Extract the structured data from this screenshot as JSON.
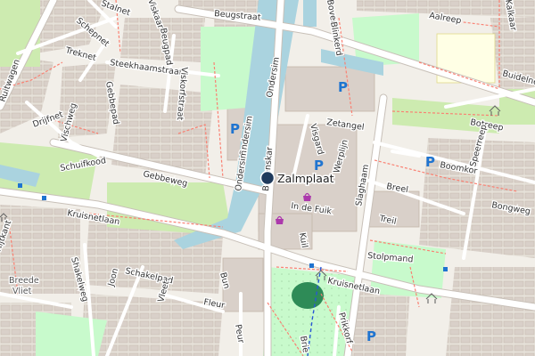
{
  "map": {
    "place": {
      "name": "Zalmplaat"
    },
    "streets": {
      "stalnet": "Stalnet",
      "viskaar": "Viskaar",
      "beugstraat": "Beugstraat",
      "bovensloot": "Bovensl",
      "aalreep": "Aalreep",
      "kalkaar": "Kalkaar",
      "schepnet": "Schepnet",
      "treknet": "Treknet",
      "beugpad": "Beugpad",
      "blinkerd": "Blinkerd",
      "steekhaamstraat": "Steekhaamstraat",
      "ruitwagen": "Ruitwagen",
      "gebbepad": "Gebbepad",
      "viskorfstraat": "Viskorfstraat",
      "ondersim_1": "Ondersim",
      "ondersim_2": "Ondersim",
      "ondersim_3": "Ondersim",
      "visgard": "Visgard",
      "zetangel": "Zetangel",
      "buidelnet": "Buidelnet",
      "botreep": "Botreep",
      "drijfnet": "Drijfnet",
      "vischweg": "Visch­weg",
      "schuifkood": "Schuifkood",
      "werplijn": "Werplijn",
      "speerreep": "Speerreep",
      "boomkor": "Boomkor",
      "gebbeweg": "Gebbeweg",
      "bovenskar": "Bovenskar",
      "slaghaam": "Slaghaam",
      "breel": "Breel",
      "bongweg": "Bongweg",
      "kruisnetlaan_1": "Kruisnetlaan",
      "in_de_fuik": "In de Fuik",
      "treil": "Treil",
      "kuil": "Kuil",
      "stolpmand": "Stolpmand",
      "shakelweg": "Shakelweg",
      "schakelpad": "Schakelpad",
      "bun": "Bun",
      "kruisnetlaan_2": "Kruisnetlaan",
      "joon": "Joon",
      "vleet": "Vleet",
      "fleur": "Fleur",
      "peur": "Peur",
      "brie": "Brie",
      "prikkorf": "Prikkorf",
      "rijtkant": "Rijtkant"
    },
    "districts": {
      "breede_vliet_1": "Breede",
      "breede_vliet_2": "Vliet"
    },
    "parking_label": "P",
    "colors": {
      "background": "#f2efe9",
      "building": "#d9d0c9",
      "park": "#c8facc",
      "grass": "#cdebb0",
      "water": "#aad3df",
      "school": "#ffffe5",
      "major_road": "#ffffff",
      "footway": "#fa8072",
      "marker": "#1f3a5c",
      "parking": "#1f74d0",
      "shop": "#ac39ac",
      "bus_stop": "#1f74d0"
    }
  }
}
